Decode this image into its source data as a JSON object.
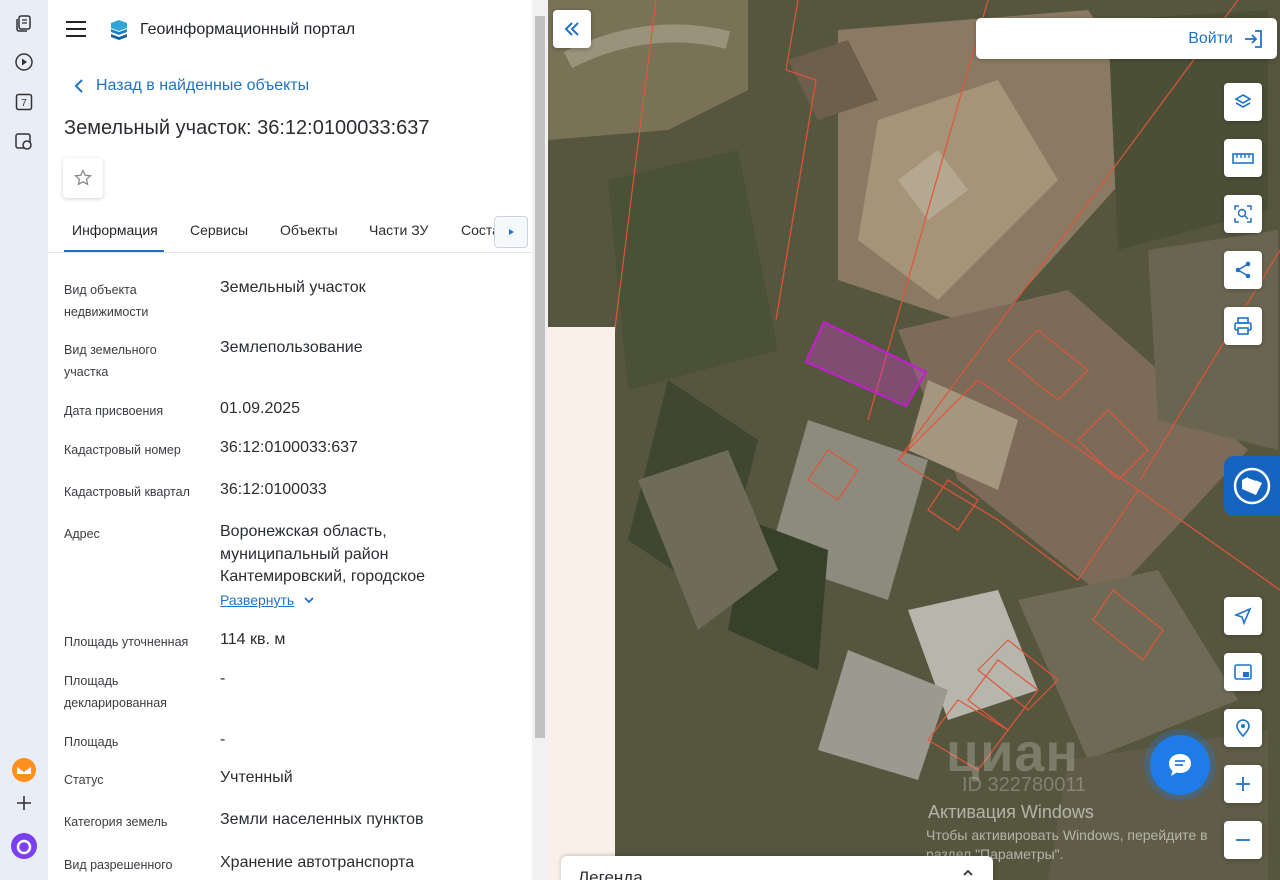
{
  "header": {
    "portal_title": "Геоинформационный портал",
    "back_label": "Назад в найденные объекты",
    "object_title": "Земельный участок: 36:12:0100033:637"
  },
  "tabs": [
    {
      "label": "Информация",
      "active": true
    },
    {
      "label": "Сервисы",
      "active": false
    },
    {
      "label": "Объекты",
      "active": false
    },
    {
      "label": "Части ЗУ",
      "active": false
    },
    {
      "label": "Состав",
      "active": false
    }
  ],
  "info": {
    "object_type_label": "Вид объекта недвижимости",
    "object_type_value": "Земельный участок",
    "land_kind_label": "Вид земельного участка",
    "land_kind_value": "Землепользование",
    "date_label": "Дата присвоения",
    "date_value": "01.09.2025",
    "cadastral_number_label": "Кадастровый номер",
    "cadastral_number_value": "36:12:0100033:637",
    "cadastral_quarter_label": "Кадастровый квартал",
    "cadastral_quarter_value": "36:12:0100033",
    "address_label": "Адрес",
    "address_value": "Воронежская область, муниципальный район Кантемировский, городское",
    "expand_label": "Развернуть",
    "area_specified_label": "Площадь уточненная",
    "area_specified_value": "114 кв. м",
    "area_declared_label": "Площадь декларированная",
    "area_declared_value": "-",
    "area_label": "Площадь",
    "area_value": "-",
    "status_label": "Статус",
    "status_value": "Учтенный",
    "land_category_label": "Категория земель",
    "land_category_value": "Земли населенных пунктов",
    "permitted_use_label": "Вид разрешенного",
    "permitted_use_value": "Хранение автотранспорта"
  },
  "map": {
    "login_label": "Войти",
    "legend_label": "Легенда",
    "watermark_cian": "циан",
    "watermark_id": "ID 322780011",
    "activation_title": "Активация Windows",
    "activation_text": "Чтобы активировать Windows, перейдите в раздел \"Параметры\"."
  },
  "browser_strip": {
    "badge_number": "7"
  },
  "colors": {
    "accent": "#1f73c6",
    "parcel_border": "#e0553a",
    "selected_parcel": "#c020c8",
    "edge_tab": "#1565c0"
  }
}
